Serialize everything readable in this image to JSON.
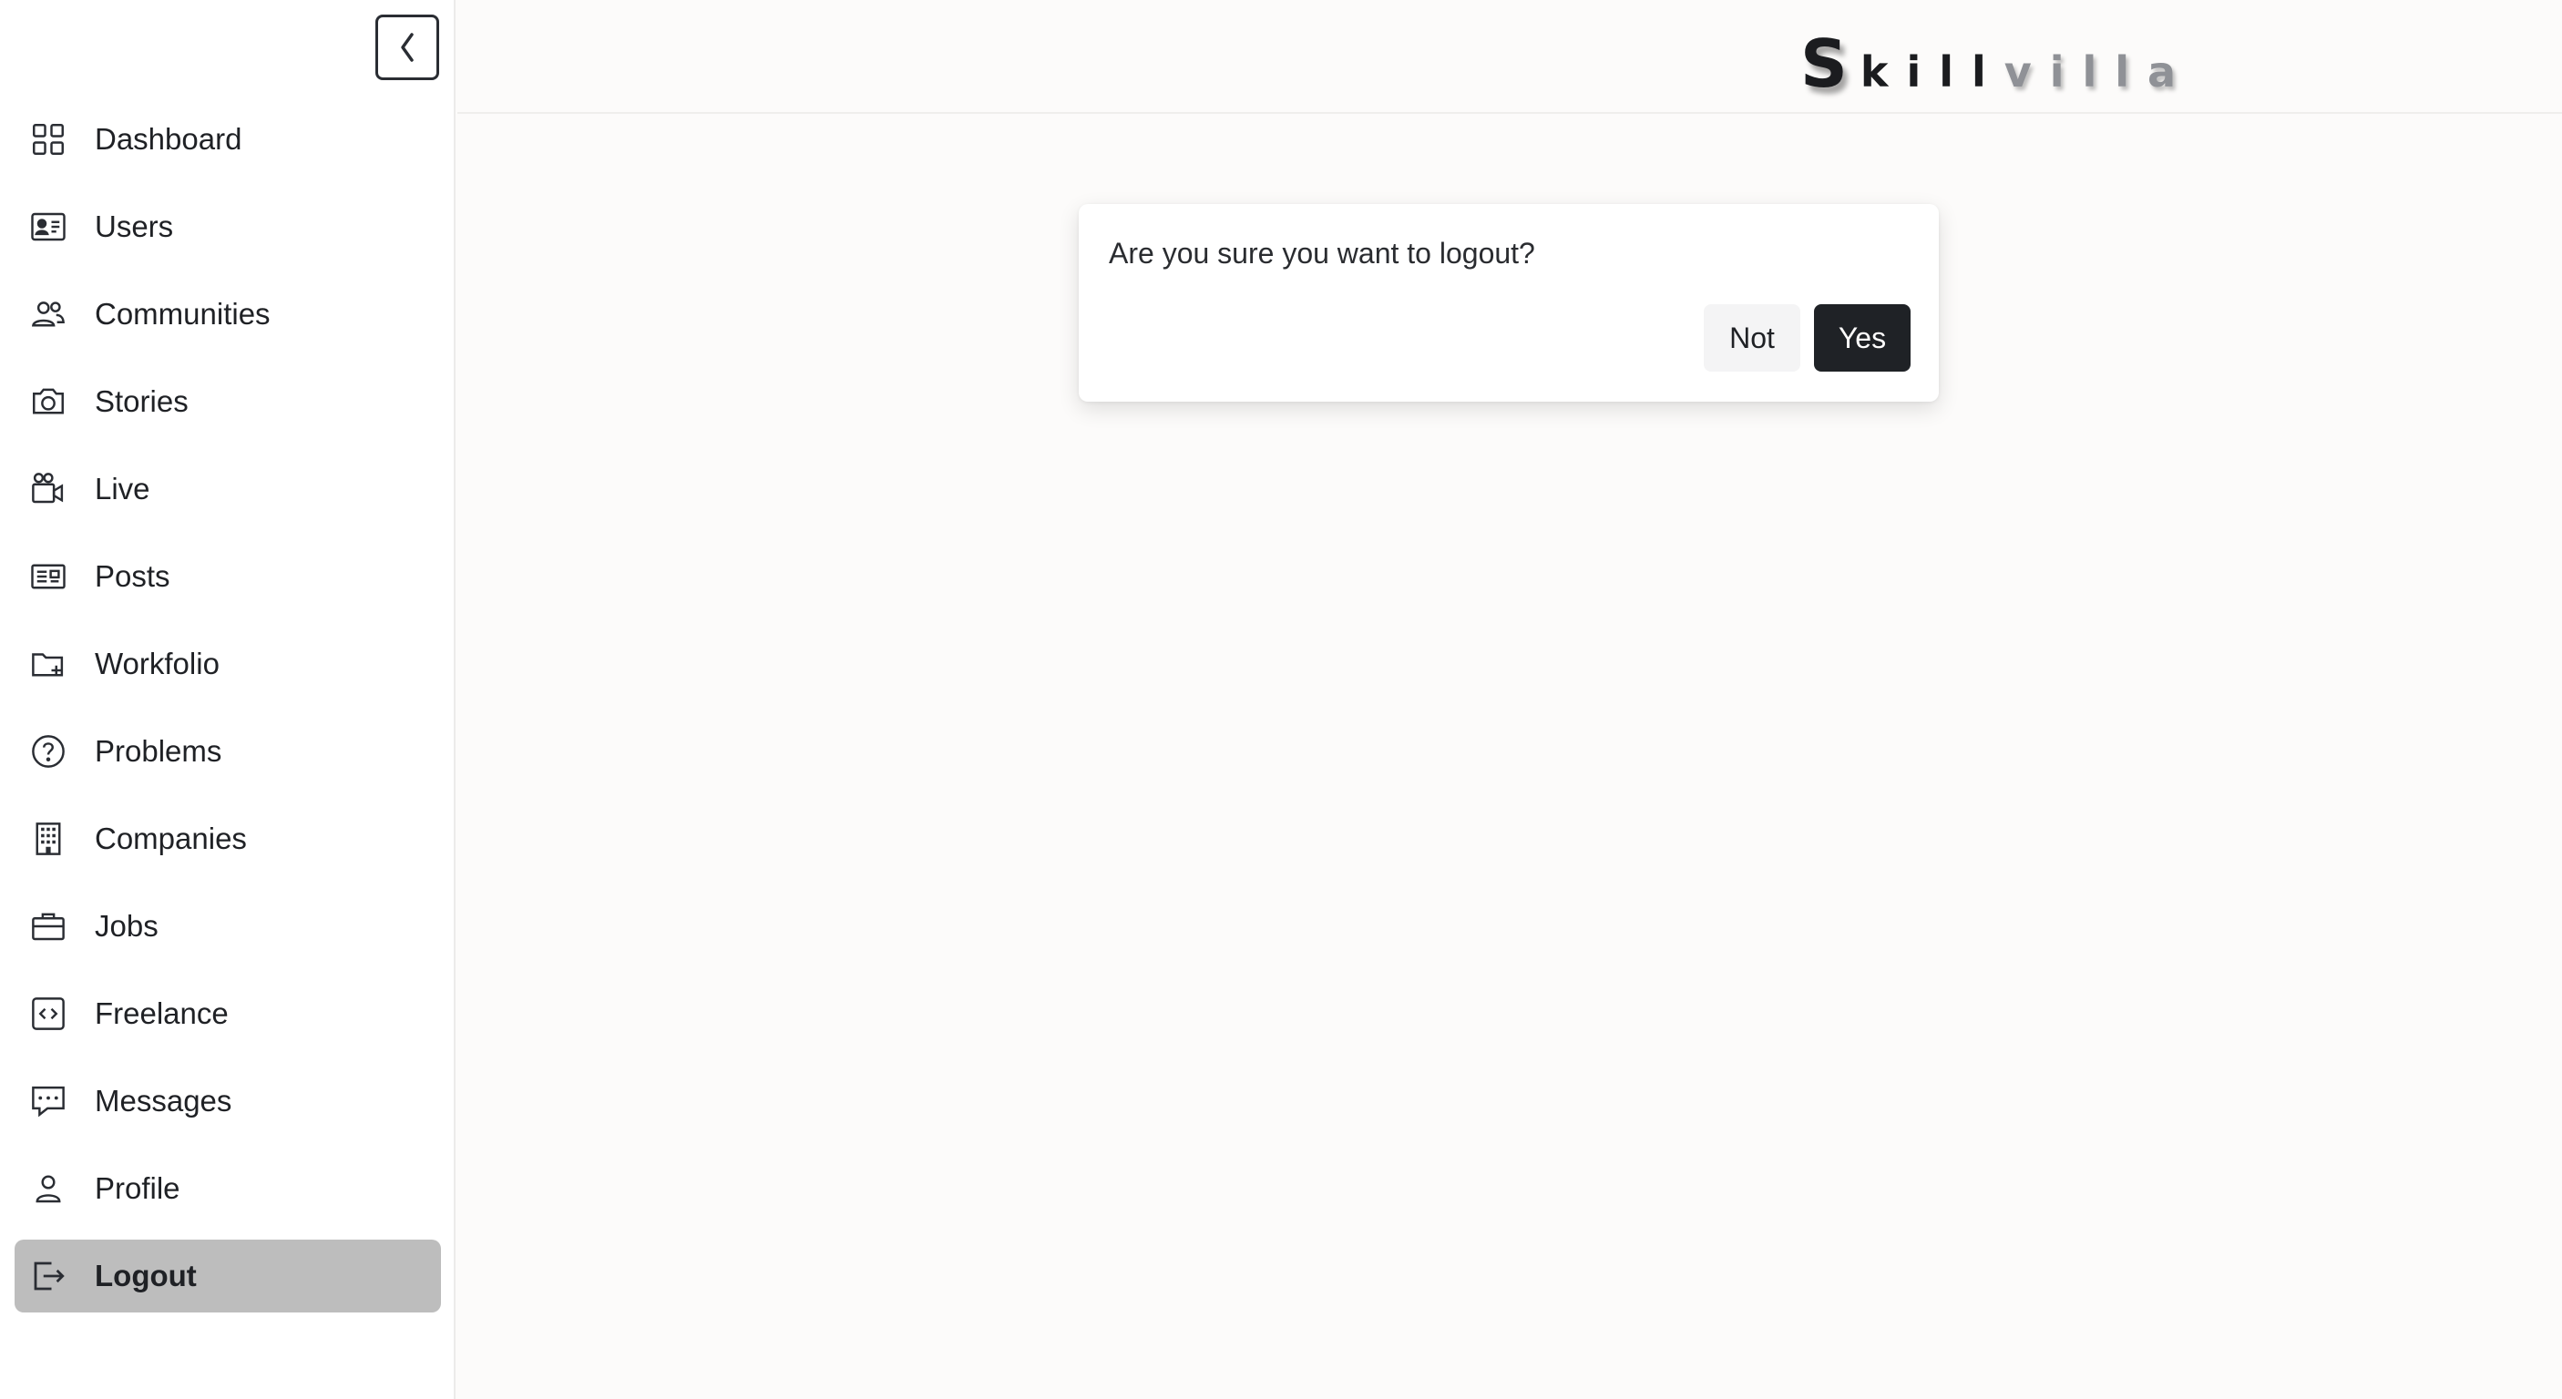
{
  "brand": {
    "logo_first_letter": "S",
    "logo_dark_part": "kill",
    "logo_light_part": "villa"
  },
  "sidebar": {
    "collapse_icon": "chevron-left-icon",
    "items": [
      {
        "label": "Dashboard",
        "icon": "grid-icon",
        "active": false
      },
      {
        "label": "Users",
        "icon": "id-card-icon",
        "active": false
      },
      {
        "label": "Communities",
        "icon": "people-icon",
        "active": false
      },
      {
        "label": "Stories",
        "icon": "camera-icon",
        "active": false
      },
      {
        "label": "Live",
        "icon": "video-camera-icon",
        "active": false
      },
      {
        "label": "Posts",
        "icon": "newspaper-icon",
        "active": false
      },
      {
        "label": "Workfolio",
        "icon": "folder-plus-icon",
        "active": false
      },
      {
        "label": "Problems",
        "icon": "question-circle-icon",
        "active": false
      },
      {
        "label": "Companies",
        "icon": "building-icon",
        "active": false
      },
      {
        "label": "Jobs",
        "icon": "briefcase-icon",
        "active": false
      },
      {
        "label": "Freelance",
        "icon": "code-square-icon",
        "active": false
      },
      {
        "label": "Messages",
        "icon": "chat-dots-icon",
        "active": false
      },
      {
        "label": "Profile",
        "icon": "person-icon",
        "active": false
      },
      {
        "label": "Logout",
        "icon": "logout-icon",
        "active": true
      }
    ]
  },
  "dialog": {
    "message": "Are you sure you want to logout?",
    "not_label": "Not",
    "yes_label": "Yes"
  },
  "colors": {
    "accent_dark": "#1f2226",
    "active_item_bg": "#bdbdbd",
    "page_bg": "#fcfbfa"
  }
}
